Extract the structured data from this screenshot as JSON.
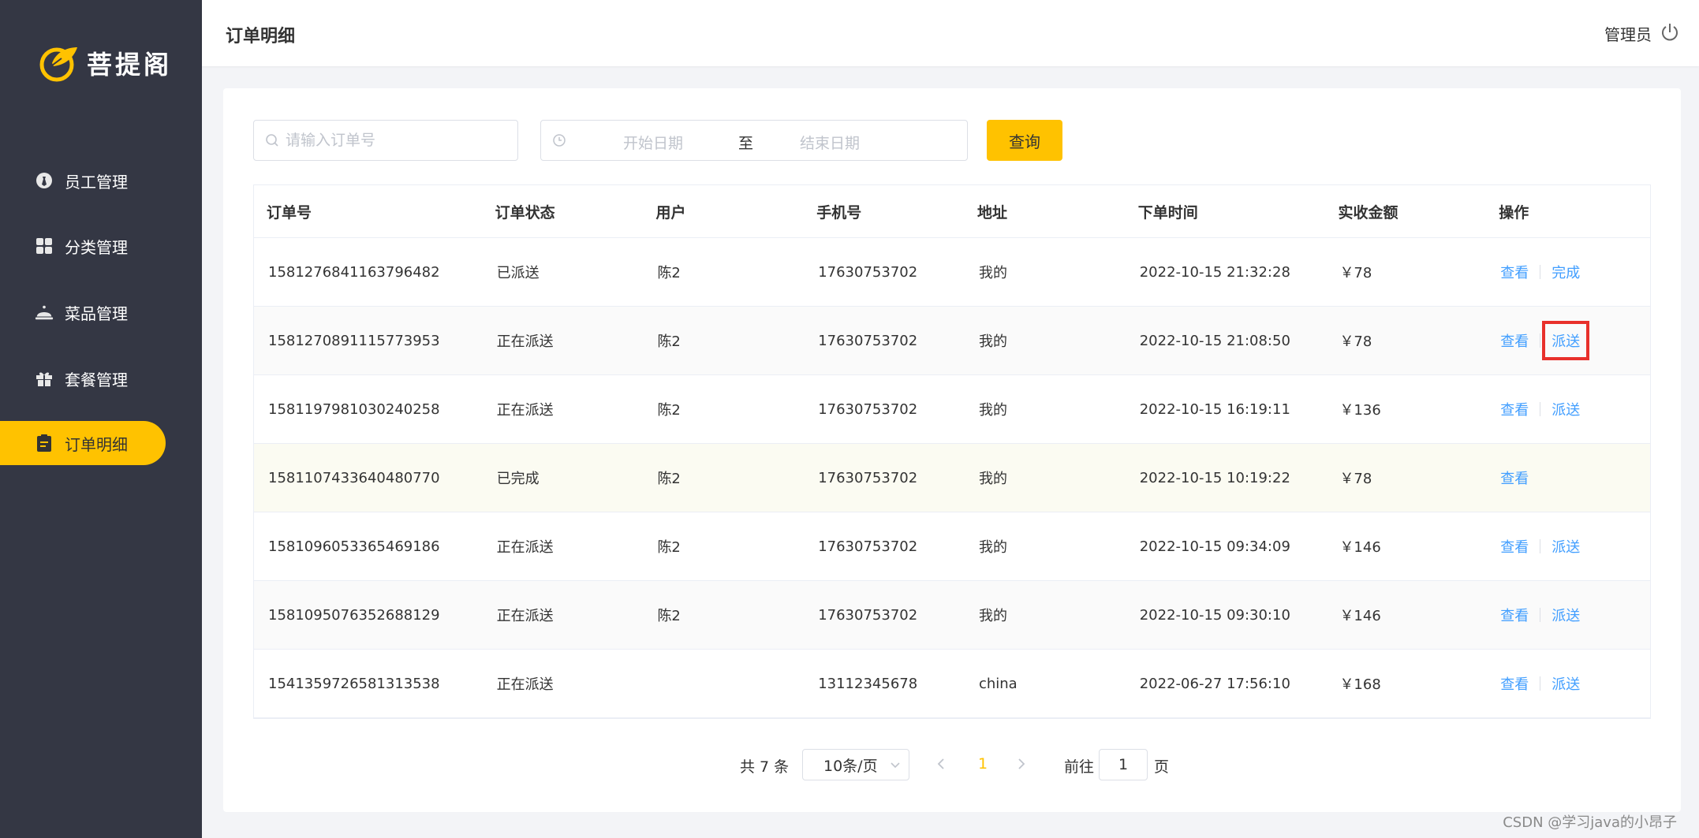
{
  "sidebar": {
    "brand": "菩提阁",
    "items": [
      {
        "label": "员工管理",
        "icon": "employee-icon"
      },
      {
        "label": "分类管理",
        "icon": "category-grid-icon"
      },
      {
        "label": "菜品管理",
        "icon": "dish-cloche-icon"
      },
      {
        "label": "套餐管理",
        "icon": "gift-icon"
      },
      {
        "label": "订单明细",
        "icon": "clipboard-icon",
        "active": true
      }
    ]
  },
  "header": {
    "title": "订单明细",
    "user": "管理员"
  },
  "search": {
    "placeholder": "请输入订单号",
    "date_start_placeholder": "开始日期",
    "date_separator": "至",
    "date_end_placeholder": "结束日期",
    "query_label": "查询"
  },
  "table": {
    "columns": [
      "订单号",
      "订单状态",
      "用户",
      "手机号",
      "地址",
      "下单时间",
      "实收金额",
      "操作"
    ],
    "rows": [
      {
        "id": "1581276841163796482",
        "status": "已派送",
        "user": "陈2",
        "phone": "17630753702",
        "address": "我的",
        "time": "2022-10-15 21:32:28",
        "amount": "￥78",
        "actions": [
          "查看",
          "完成"
        ]
      },
      {
        "id": "1581270891115773953",
        "status": "正在派送",
        "user": "陈2",
        "phone": "17630753702",
        "address": "我的",
        "time": "2022-10-15 21:08:50",
        "amount": "￥78",
        "actions": [
          "查看",
          "派送"
        ]
      },
      {
        "id": "1581197981030240258",
        "status": "正在派送",
        "user": "陈2",
        "phone": "17630753702",
        "address": "我的",
        "time": "2022-10-15 16:19:11",
        "amount": "￥136",
        "actions": [
          "查看",
          "派送"
        ]
      },
      {
        "id": "1581107433640480770",
        "status": "已完成",
        "user": "陈2",
        "phone": "17630753702",
        "address": "我的",
        "time": "2022-10-15 10:19:22",
        "amount": "￥78",
        "actions": [
          "查看"
        ]
      },
      {
        "id": "1581096053365469186",
        "status": "正在派送",
        "user": "陈2",
        "phone": "17630753702",
        "address": "我的",
        "time": "2022-10-15 09:34:09",
        "amount": "￥146",
        "actions": [
          "查看",
          "派送"
        ]
      },
      {
        "id": "1581095076352688129",
        "status": "正在派送",
        "user": "陈2",
        "phone": "17630753702",
        "address": "我的",
        "time": "2022-10-15 09:30:10",
        "amount": "￥146",
        "actions": [
          "查看",
          "派送"
        ]
      },
      {
        "id": "1541359726581313538",
        "status": "正在派送",
        "user": "",
        "phone": "13112345678",
        "address": "china",
        "time": "2022-06-27 17:56:10",
        "amount": "￥168",
        "actions": [
          "查看",
          "派送"
        ]
      }
    ]
  },
  "pagination": {
    "total": "共 7 条",
    "page_size": "10条/页",
    "current_page": "1",
    "goto_label": "前往",
    "goto_value": "1",
    "page_unit": "页"
  },
  "watermark": "CSDN @学习java的小昂子",
  "colors": {
    "sidebar_bg": "#343744",
    "accent": "#ffc200",
    "link": "#419eff",
    "highlight_box": "#e8302b"
  }
}
